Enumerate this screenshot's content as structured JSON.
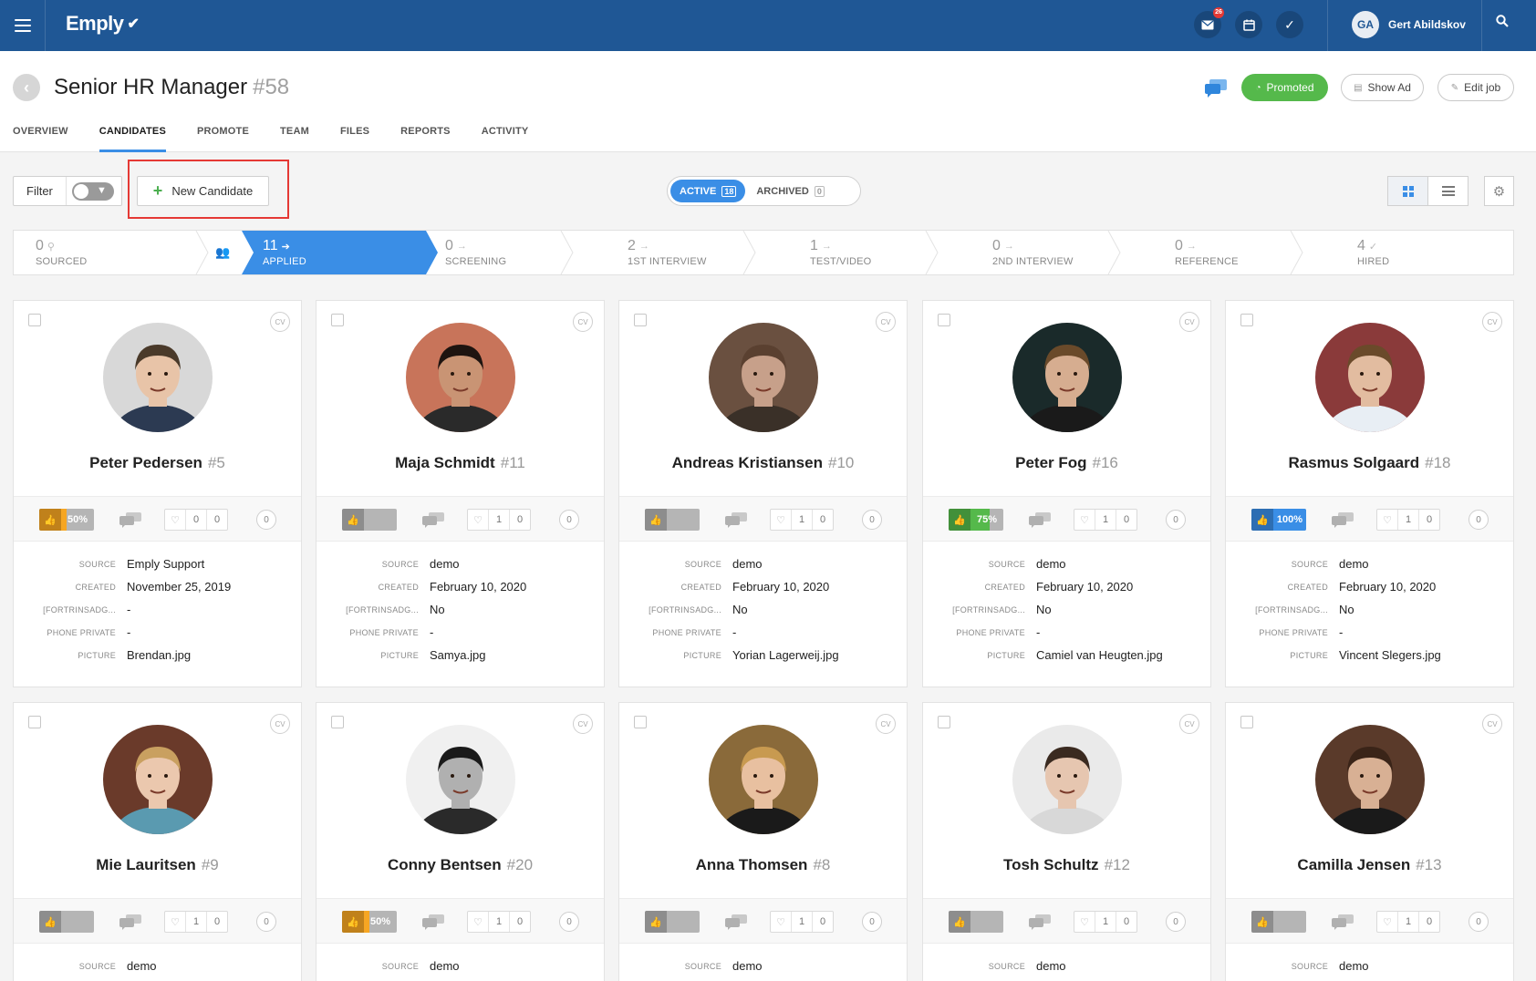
{
  "topbar": {
    "brand": "Emply",
    "mail_badge": "26",
    "user_initials": "GA",
    "user_name": "Gert Abildskov"
  },
  "job": {
    "title": "Senior HR Manager",
    "id": "#58",
    "promoted_label": "Promoted",
    "show_ad_label": "Show Ad",
    "edit_job_label": "Edit job"
  },
  "tabs": [
    "OVERVIEW",
    "CANDIDATES",
    "PROMOTE",
    "TEAM",
    "FILES",
    "REPORTS",
    "ACTIVITY"
  ],
  "active_tab": "CANDIDATES",
  "toolbar": {
    "filter_label": "Filter",
    "new_candidate_label": "New Candidate",
    "active_label": "ACTIVE",
    "active_count": "18",
    "archived_label": "ARCHIVED",
    "archived_count": "0"
  },
  "pipeline": [
    {
      "count": "0",
      "label": "SOURCED"
    },
    {
      "count": "11",
      "label": "APPLIED",
      "active": true
    },
    {
      "count": "0",
      "label": "SCREENING"
    },
    {
      "count": "2",
      "label": "1ST INTERVIEW"
    },
    {
      "count": "1",
      "label": "TEST/VIDEO"
    },
    {
      "count": "0",
      "label": "2ND INTERVIEW"
    },
    {
      "count": "0",
      "label": "REFERENCE"
    },
    {
      "count": "4",
      "label": "HIRED"
    }
  ],
  "field_labels": {
    "source": "SOURCE",
    "created": "CREATED",
    "fortrinsad": "[FORTRINSADG...",
    "phone": "PHONE PRIVATE",
    "picture": "PICTURE"
  },
  "cv_label": "CV",
  "candidates": [
    {
      "name": "Peter Pedersen",
      "num": "#5",
      "rating": "50%",
      "rating_level": 0.5,
      "rating_color": "#f6a623",
      "likes": "0",
      "dislikes": "0",
      "messages": "0",
      "source": "Emply Support",
      "created": "November 25, 2019",
      "fortrinsad": "-",
      "phone": "-",
      "picture": "Brendan.jpg",
      "skin": "#e8c4a8",
      "hair": "#4a3a2a",
      "bg": "#d8d8d8",
      "shirt": "#2c3a52"
    },
    {
      "name": "Maja Schmidt",
      "num": "#11",
      "rating": "",
      "rating_level": 0,
      "rating_color": "#b5b5b5",
      "likes": "1",
      "dislikes": "0",
      "messages": "0",
      "source": "demo",
      "created": "February 10, 2020",
      "fortrinsad": "No",
      "phone": "-",
      "picture": "Samya.jpg",
      "skin": "#c99474",
      "hair": "#1e1410",
      "bg": "#c8745a",
      "shirt": "#2a2a2a"
    },
    {
      "name": "Andreas Kristiansen",
      "num": "#10",
      "rating": "",
      "rating_level": 0,
      "rating_color": "#b5b5b5",
      "likes": "1",
      "dislikes": "0",
      "messages": "0",
      "source": "demo",
      "created": "February 10, 2020",
      "fortrinsad": "No",
      "phone": "-",
      "picture": "Yorian Lagerweij.jpg",
      "skin": "#c7a08a",
      "hair": "#5a4030",
      "bg": "#6a5040",
      "shirt": "#3a3028"
    },
    {
      "name": "Peter Fog",
      "num": "#16",
      "rating": "75%",
      "rating_level": 0.75,
      "rating_color": "#55b94b",
      "likes": "1",
      "dislikes": "0",
      "messages": "0",
      "source": "demo",
      "created": "February 10, 2020",
      "fortrinsad": "No",
      "phone": "-",
      "picture": "Camiel van Heugten.jpg",
      "skin": "#d6ad90",
      "hair": "#6a4a2a",
      "bg": "#1a2a2a",
      "shirt": "#1a1a1a"
    },
    {
      "name": "Rasmus Solgaard",
      "num": "#18",
      "rating": "100%",
      "rating_level": 1,
      "rating_color": "#3a8ee6",
      "likes": "1",
      "dislikes": "0",
      "messages": "0",
      "source": "demo",
      "created": "February 10, 2020",
      "fortrinsad": "No",
      "phone": "-",
      "picture": "Vincent Slegers.jpg",
      "skin": "#e2bca0",
      "hair": "#6a4a2a",
      "bg": "#8a3a3a",
      "shirt": "#e8eef4"
    },
    {
      "name": "Mie Lauritsen",
      "num": "#9",
      "rating": "",
      "rating_level": 0,
      "rating_color": "#b5b5b5",
      "likes": "1",
      "dislikes": "0",
      "messages": "0",
      "source": "demo",
      "skin": "#ebc8ae",
      "hair": "#c9a060",
      "bg": "#6a3a2a",
      "shirt": "#5a9ab0"
    },
    {
      "name": "Conny Bentsen",
      "num": "#20",
      "rating": "50%",
      "rating_level": 0.5,
      "rating_color": "#f6a623",
      "likes": "1",
      "dislikes": "0",
      "messages": "0",
      "source": "demo",
      "skin": "#b0b0b0",
      "hair": "#1a1a1a",
      "bg": "#f0f0f0",
      "shirt": "#2a2a2a"
    },
    {
      "name": "Anna Thomsen",
      "num": "#8",
      "rating": "",
      "rating_level": 0,
      "rating_color": "#b5b5b5",
      "likes": "1",
      "dislikes": "0",
      "messages": "0",
      "source": "demo",
      "skin": "#e8c0a0",
      "hair": "#c89a50",
      "bg": "#8a6a3a",
      "shirt": "#1a1a1a"
    },
    {
      "name": "Tosh Schultz",
      "num": "#12",
      "rating": "",
      "rating_level": 0,
      "rating_color": "#b5b5b5",
      "likes": "1",
      "dislikes": "0",
      "messages": "0",
      "source": "demo",
      "skin": "#e6c6b0",
      "hair": "#3a2a20",
      "bg": "#eaeaea",
      "shirt": "#d8d8d8"
    },
    {
      "name": "Camilla Jensen",
      "num": "#13",
      "rating": "",
      "rating_level": 0,
      "rating_color": "#b5b5b5",
      "likes": "1",
      "dislikes": "0",
      "messages": "0",
      "source": "demo",
      "skin": "#d8b094",
      "hair": "#3a2418",
      "bg": "#5a3a2a",
      "shirt": "#1a1a1a"
    }
  ]
}
